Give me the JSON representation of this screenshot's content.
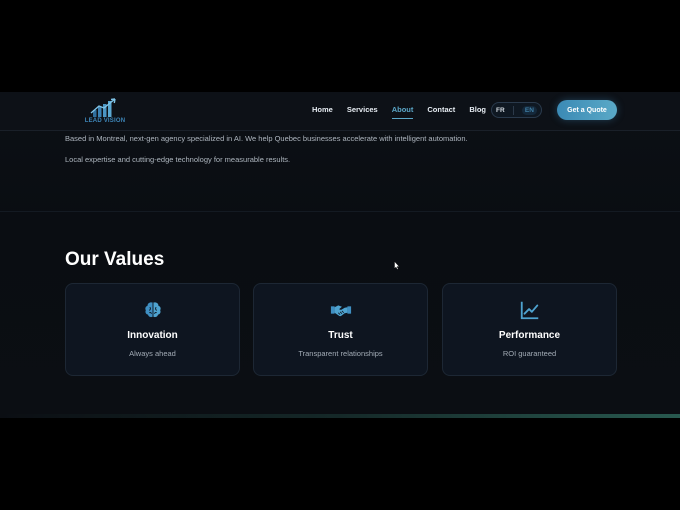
{
  "brand": {
    "name": "LEAD VISION",
    "accent": "#4a9ec6"
  },
  "nav": {
    "items": [
      {
        "label": "Home",
        "active": false
      },
      {
        "label": "Services",
        "active": false
      },
      {
        "label": "About",
        "active": true
      },
      {
        "label": "Contact",
        "active": false
      },
      {
        "label": "Blog",
        "active": false
      }
    ],
    "lang": {
      "fr": "FR",
      "en": "EN",
      "selected": "EN"
    },
    "cta_label": "Get a Quote"
  },
  "about": {
    "line1": "Based in Montreal, next-gen agency specialized in AI. We help Quebec businesses accelerate with intelligent automation.",
    "line2": "Local expertise and cutting-edge technology for measurable results."
  },
  "values": {
    "title": "Our Values",
    "cards": [
      {
        "icon": "brain-icon",
        "title": "Innovation",
        "subtitle": "Always ahead"
      },
      {
        "icon": "handshake-icon",
        "title": "Trust",
        "subtitle": "Transparent relationships"
      },
      {
        "icon": "chart-line-icon",
        "title": "Performance",
        "subtitle": "ROI guaranteed"
      }
    ]
  }
}
